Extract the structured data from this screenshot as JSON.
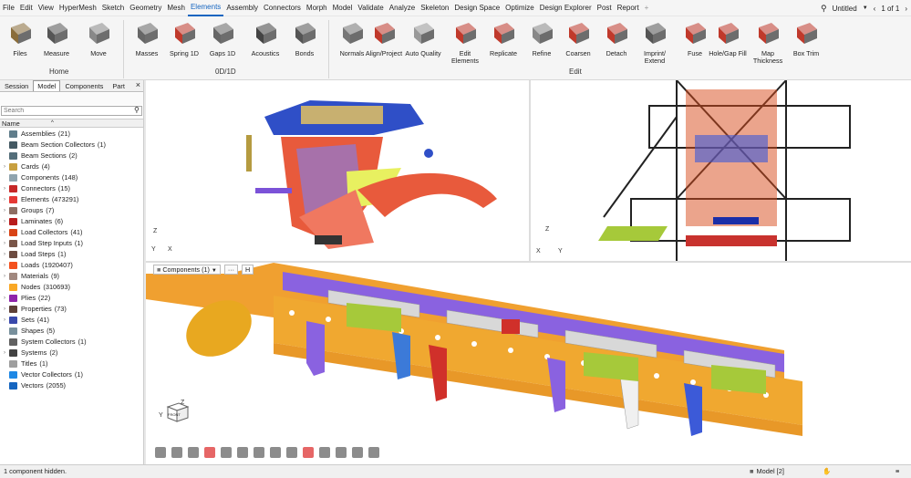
{
  "menu": {
    "items": [
      "File",
      "Edit",
      "View",
      "HyperMesh",
      "Sketch",
      "Geometry",
      "Mesh",
      "Elements",
      "Assembly",
      "Connectors",
      "Morph",
      "Model",
      "Validate",
      "Analyze",
      "Skeleton",
      "Design Space",
      "Optimize",
      "Design Explorer",
      "Post",
      "Report"
    ],
    "active": "Elements",
    "plus": "+",
    "doc_title": "Untitled",
    "page": "1 of 1"
  },
  "ribbon": {
    "home": {
      "group": "Home",
      "tools": [
        "Files",
        "Measure",
        "Move"
      ]
    },
    "zerod": {
      "group": "0D/1D",
      "tools": [
        "Masses",
        "Spring 1D",
        "Gaps 1D",
        "Acoustics",
        "Bonds"
      ]
    },
    "edit": {
      "group": "Edit",
      "tools": [
        "Normals",
        "Align/Project",
        "Auto Quality",
        "Edit Elements",
        "Replicate",
        "Refine",
        "Coarsen",
        "Detach",
        "Imprint/ Extend",
        "Fuse",
        "Hole/Gap Fill",
        "Map Thickness",
        "Box Trim"
      ]
    }
  },
  "left": {
    "tabs": [
      "Session",
      "Model",
      "Components",
      "Part"
    ],
    "active_tab": "Model",
    "search_placeholder": "Search",
    "col_name": "Name",
    "tree": [
      {
        "label": "Assemblies",
        "count": "(21)",
        "exp": false,
        "color": "#607d8b"
      },
      {
        "label": "Beam Section Collectors",
        "count": "(1)",
        "exp": false,
        "color": "#455a64"
      },
      {
        "label": "Beam Sections",
        "count": "(2)",
        "exp": false,
        "color": "#546e7a"
      },
      {
        "label": "Cards",
        "count": "(4)",
        "exp": true,
        "color": "#c8a040"
      },
      {
        "label": "Components",
        "count": "(148)",
        "exp": false,
        "color": "#90a4ae"
      },
      {
        "label": "Connectors",
        "count": "(15)",
        "exp": true,
        "color": "#c62828"
      },
      {
        "label": "Elements",
        "count": "(473291)",
        "exp": true,
        "color": "#e53935"
      },
      {
        "label": "Groups",
        "count": "(7)",
        "exp": true,
        "color": "#8d6e63"
      },
      {
        "label": "Laminates",
        "count": "(6)",
        "exp": true,
        "color": "#b71c1c"
      },
      {
        "label": "Load Collectors",
        "count": "(41)",
        "exp": true,
        "color": "#d84315"
      },
      {
        "label": "Load Step Inputs",
        "count": "(1)",
        "exp": true,
        "color": "#795548"
      },
      {
        "label": "Load Steps",
        "count": "(1)",
        "exp": true,
        "color": "#6d4c41"
      },
      {
        "label": "Loads",
        "count": "(1920407)",
        "exp": true,
        "color": "#f4511e"
      },
      {
        "label": "Materials",
        "count": "(9)",
        "exp": true,
        "color": "#a1887f"
      },
      {
        "label": "Nodes",
        "count": "(310693)",
        "exp": false,
        "color": "#f9a825"
      },
      {
        "label": "Plies",
        "count": "(22)",
        "exp": true,
        "color": "#8e24aa"
      },
      {
        "label": "Properties",
        "count": "(73)",
        "exp": true,
        "color": "#5d4037"
      },
      {
        "label": "Sets",
        "count": "(41)",
        "exp": true,
        "color": "#3949ab"
      },
      {
        "label": "Shapes",
        "count": "(5)",
        "exp": false,
        "color": "#78909c"
      },
      {
        "label": "System Collectors",
        "count": "(1)",
        "exp": false,
        "color": "#616161"
      },
      {
        "label": "Systems",
        "count": "(2)",
        "exp": true,
        "color": "#424242"
      },
      {
        "label": "Titles",
        "count": "(1)",
        "exp": false,
        "color": "#9e9e9e"
      },
      {
        "label": "Vector Collectors",
        "count": "(1)",
        "exp": false,
        "color": "#1e88e5"
      },
      {
        "label": "Vectors",
        "count": "(2055)",
        "exp": false,
        "color": "#1565c0"
      }
    ]
  },
  "view": {
    "components_label": "Components (1)",
    "more": "···",
    "pin": "H",
    "axis_x": "X",
    "axis_y": "Y",
    "axis_z": "Z",
    "cube_label": "FRONT"
  },
  "status": {
    "message": "1 component hidden.",
    "model_label": "Model [2]"
  },
  "colors": {
    "accent": "#1565c0",
    "orange": "#f5a623",
    "purple": "#7b52d8",
    "red": "#d32f2f"
  }
}
